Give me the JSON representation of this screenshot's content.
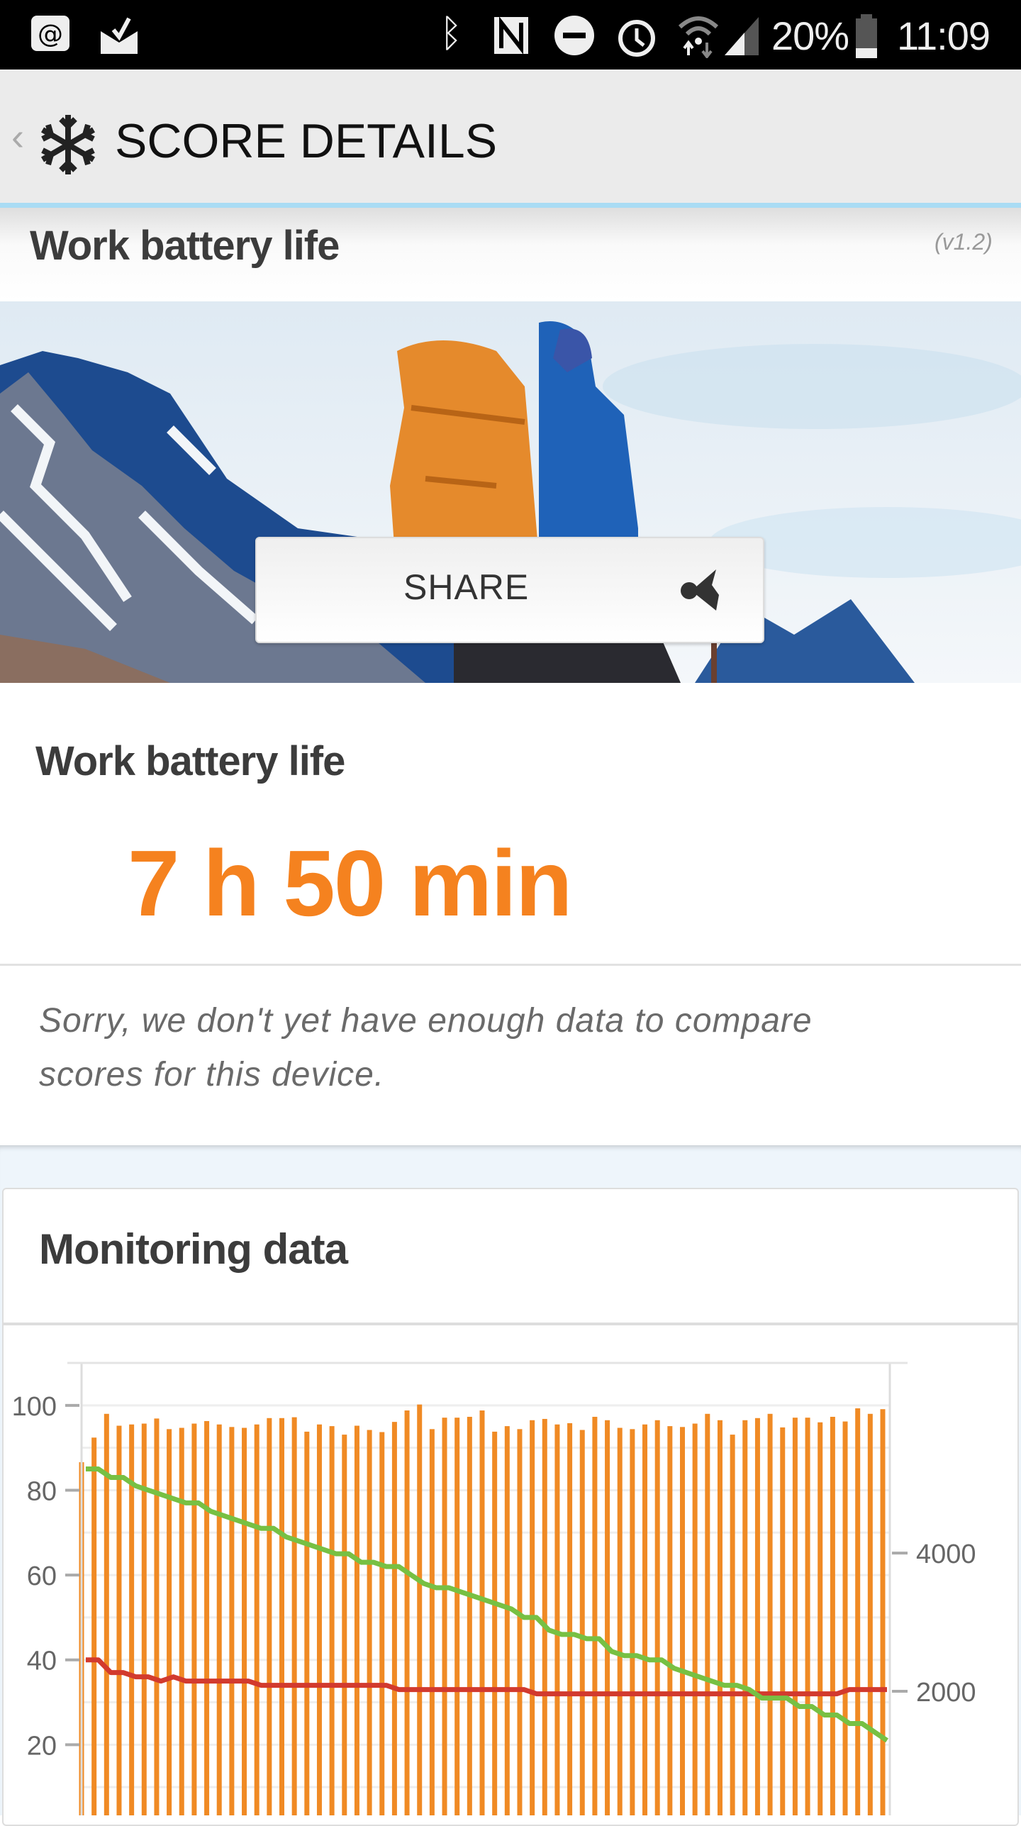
{
  "status_bar": {
    "battery": "20%",
    "time": "11:09",
    "icons": [
      "email-icon",
      "mail-check-icon",
      "bluetooth-icon",
      "nfc-icon",
      "do-not-disturb-icon",
      "alarm-icon",
      "wifi-icon",
      "signal-icon",
      "battery-icon"
    ]
  },
  "app_bar": {
    "title": "SCORE DETAILS",
    "back_icon": "chevron-left-icon",
    "logo_icon": "snowflake-icon"
  },
  "test": {
    "name": "Work battery life",
    "version": "(v1.2)"
  },
  "share": {
    "label": "SHARE",
    "icon": "share-icon"
  },
  "result": {
    "title": "Work battery life",
    "score": "7 h 50 min",
    "note_line1": "Sorry, we don't yet have enough data to compare",
    "note_line2": "scores for this device."
  },
  "monitoring": {
    "title": "Monitoring data"
  },
  "colors": {
    "accent": "#f5821f",
    "bars": "#f08a24",
    "battery_line": "#77c043",
    "temp_line": "#d23a2e"
  },
  "chart_data": {
    "type": "bar",
    "left_axis": {
      "ylim": [
        0,
        110
      ],
      "ticks": [
        "20",
        "40",
        "60",
        "80",
        "100"
      ]
    },
    "right_axis": {
      "ylim": [
        0,
        6750
      ],
      "ticks": [
        "2000",
        "4000"
      ]
    },
    "grid": true,
    "series": [
      {
        "type": "bar",
        "axis": "left",
        "values": [
          86.6,
          92.4,
          98,
          95.2,
          95.5,
          95.7,
          96.9,
          94.4,
          94.7,
          95.7,
          96.3,
          95.5,
          94.9,
          94.7,
          95.5,
          97,
          97,
          97.2,
          93.8,
          95.5,
          95.1,
          93.1,
          95.2,
          94.2,
          93.7,
          96.1,
          98.8,
          100.2,
          94.4,
          97.1,
          97.1,
          97.3,
          98.8,
          93.8,
          95.1,
          94.4,
          96.5,
          96.8,
          95.5,
          95.8,
          94.2,
          97.3,
          96.5,
          94.7,
          94.4,
          95.5,
          96.5,
          95.1,
          94.9,
          95.7,
          98,
          96.5,
          93.1,
          96.5,
          97,
          98,
          94.8,
          97.1,
          97.1,
          96,
          97.3,
          96.2,
          99.3,
          98,
          99.1
        ]
      },
      {
        "type": "line",
        "axis": "left",
        "values": [
          85,
          85,
          83,
          83,
          81,
          80,
          79,
          78,
          77,
          77,
          75,
          74,
          73,
          72,
          71,
          71,
          69,
          68,
          67,
          66,
          65,
          65,
          63,
          63,
          62,
          62,
          60,
          58,
          57,
          57,
          56,
          55,
          54,
          53,
          52,
          50,
          50,
          47,
          46,
          46,
          45,
          45,
          42,
          41,
          41,
          40,
          40,
          38,
          37,
          36,
          35,
          34,
          34,
          33,
          31,
          31,
          31,
          29,
          29,
          27,
          27,
          25,
          25,
          23,
          21
        ]
      },
      {
        "type": "line",
        "axis": "left",
        "values": [
          40,
          40,
          37,
          37,
          36,
          36,
          35,
          36,
          35,
          35,
          35,
          35,
          35,
          35,
          34,
          34,
          34,
          34,
          34,
          34,
          34,
          34,
          34,
          34,
          34,
          33,
          33,
          33,
          33,
          33,
          33,
          33,
          33,
          33,
          33,
          33,
          32,
          32,
          32,
          32,
          32,
          32,
          32,
          32,
          32,
          32,
          32,
          32,
          32,
          32,
          32,
          32,
          32,
          32,
          32,
          32,
          32,
          32,
          32,
          32,
          32,
          33,
          33,
          33,
          33
        ]
      }
    ]
  }
}
